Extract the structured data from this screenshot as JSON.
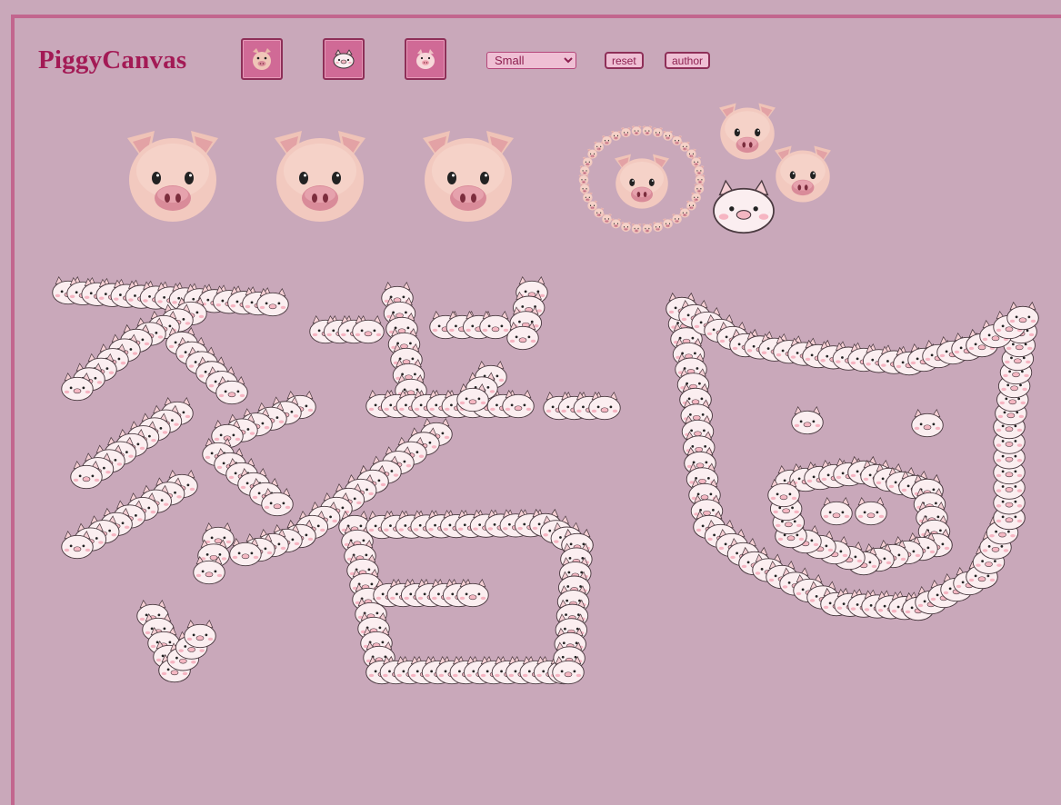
{
  "app": {
    "title": "PiggyCanvas"
  },
  "toolbar": {
    "brushes": [
      {
        "name": "realistic-pig-brush",
        "icon": "pig-face-realistic-icon"
      },
      {
        "name": "cartoon-pig-brush",
        "icon": "pig-face-cartoon-icon"
      },
      {
        "name": "emoji-pig-brush",
        "icon": "pig-face-emoji-icon"
      }
    ],
    "size": {
      "selected": "Small",
      "options": [
        "Small"
      ]
    },
    "reset_label": "reset",
    "author_label": "author"
  },
  "colors": {
    "background": "#c9a8ba",
    "accent": "#c2668e",
    "title": "#a31a55",
    "button_face": "#d06a96",
    "control_fill": "#efbfd4",
    "pig_skin": "#f2c9bf",
    "pig_snout": "#e3a0a7",
    "cartoon_face": "#fbeef0"
  },
  "canvas": {
    "content": "hand-drawn strokes made of stamped pig-face emojis"
  }
}
